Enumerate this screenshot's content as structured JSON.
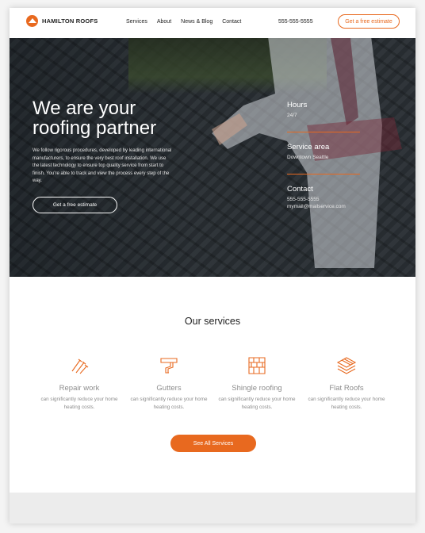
{
  "brand": {
    "name": "HAMILTON ROOFS",
    "accent": "#e8691f"
  },
  "nav": [
    "Services",
    "About",
    "News & Blog",
    "Contact"
  ],
  "header": {
    "phone": "555-555-5555",
    "estimate_button": "Get a free estimate"
  },
  "hero": {
    "title_line1": "We are your",
    "title_line2": "roofing partner",
    "body": "We follow rigorous procedures, developed by leading international manufacturers, to ensure the very best roof installation. We use the latest technology to ensure top quality service from start to finish. You're able to track and view the process every step of the way.",
    "button": "Get a free estimate",
    "info": [
      {
        "label": "Hours",
        "value": "24/7"
      },
      {
        "label": "Service area",
        "value": "Downtown Seattle"
      },
      {
        "label": "Contact",
        "value": "555-555-5555",
        "value2": "mymail@mailservice.com"
      }
    ]
  },
  "services": {
    "title": "Our services",
    "items": [
      {
        "name": "Repair work",
        "desc": "can significantly reduce your home heating costs.",
        "icon": "nails-icon"
      },
      {
        "name": "Gutters",
        "desc": "can significantly reduce your home heating costs.",
        "icon": "gutter-icon"
      },
      {
        "name": "Shingle roofing",
        "desc": "can significantly reduce your home heating costs.",
        "icon": "shingle-icon"
      },
      {
        "name": "Flat Roofs",
        "desc": "can significantly reduce your home heating costs.",
        "icon": "flat-roof-icon"
      }
    ],
    "button": "See All Services"
  }
}
